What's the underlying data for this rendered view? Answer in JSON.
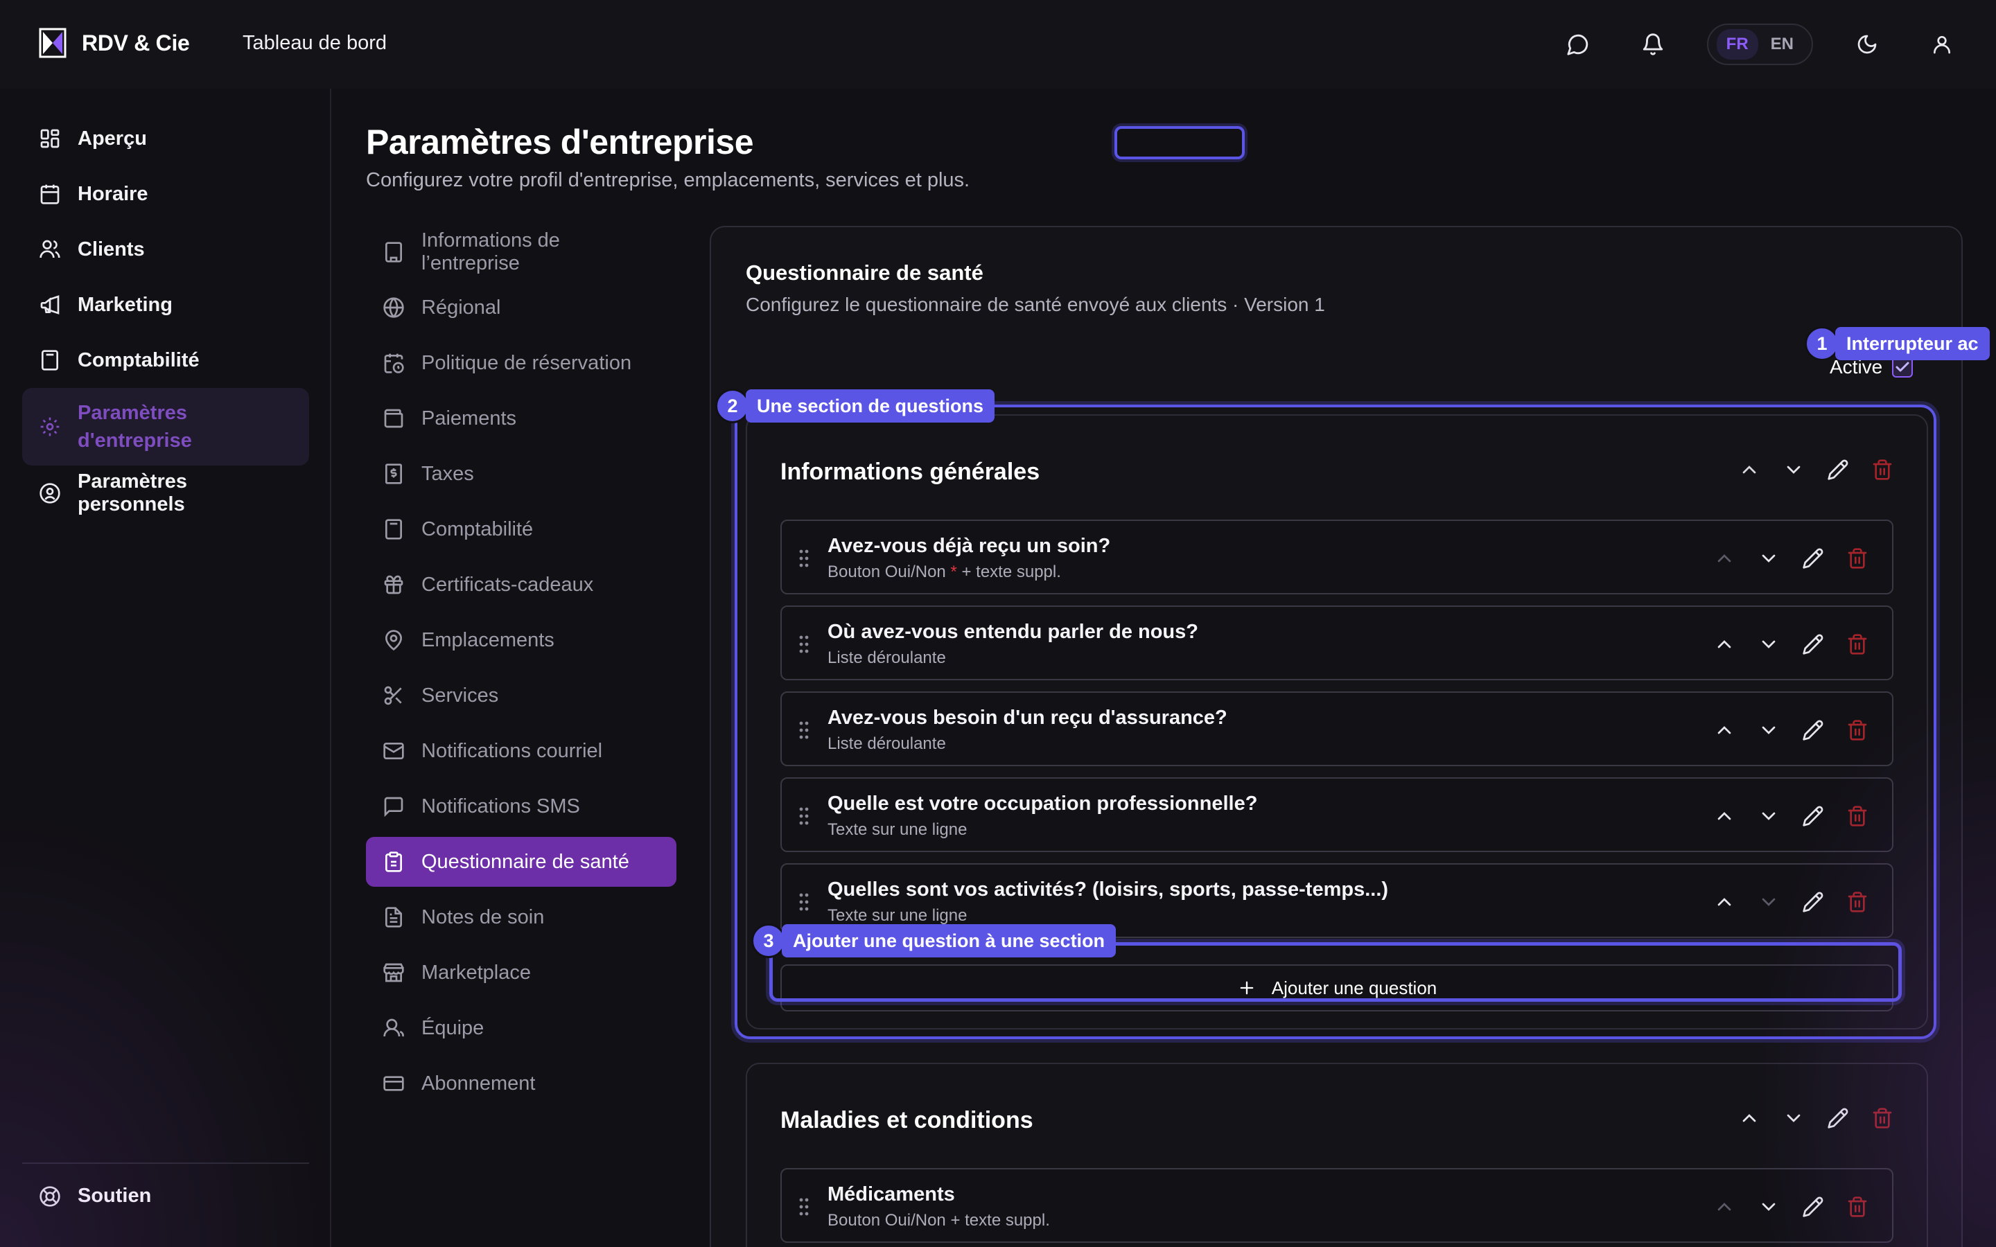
{
  "app": {
    "name": "RDV & Cie",
    "breadcrumb": "Tableau de bord"
  },
  "lang": {
    "fr": "FR",
    "en": "EN",
    "selected": "FR"
  },
  "sidebar": {
    "items": [
      {
        "label": "Aperçu",
        "icon": "dashboard-icon"
      },
      {
        "label": "Horaire",
        "icon": "calendar-icon"
      },
      {
        "label": "Clients",
        "icon": "users-icon"
      },
      {
        "label": "Marketing",
        "icon": "megaphone-icon"
      },
      {
        "label": "Comptabilité",
        "icon": "calculator-icon"
      },
      {
        "label": "Paramètres d'entreprise",
        "icon": "gear-icon",
        "active": true
      },
      {
        "label": "Paramètres personnels",
        "icon": "user-circle-icon"
      }
    ],
    "support": "Soutien"
  },
  "page": {
    "title": "Paramètres d'entreprise",
    "subtitle": "Configurez votre profil d'entreprise, emplacements, services et plus."
  },
  "settings_nav": [
    {
      "label": "Informations de l’entreprise",
      "icon": "building-icon"
    },
    {
      "label": "Régional",
      "icon": "globe-icon"
    },
    {
      "label": "Politique de réservation",
      "icon": "calendar-clock-icon"
    },
    {
      "label": "Paiements",
      "icon": "wallet-icon"
    },
    {
      "label": "Taxes",
      "icon": "receipt-dollar-icon"
    },
    {
      "label": "Comptabilité",
      "icon": "calculator-icon"
    },
    {
      "label": "Certificats-cadeaux",
      "icon": "gift-icon"
    },
    {
      "label": "Emplacements",
      "icon": "map-pin-icon"
    },
    {
      "label": "Services",
      "icon": "scissors-icon"
    },
    {
      "label": "Notifications courriel",
      "icon": "mail-icon"
    },
    {
      "label": "Notifications SMS",
      "icon": "message-square-icon"
    },
    {
      "label": "Questionnaire de santé",
      "icon": "clipboard-icon",
      "active": true
    },
    {
      "label": "Notes de soin",
      "icon": "file-text-icon"
    },
    {
      "label": "Marketplace",
      "icon": "store-icon"
    },
    {
      "label": "Équipe",
      "icon": "team-icon"
    },
    {
      "label": "Abonnement",
      "icon": "credit-card-icon"
    }
  ],
  "card": {
    "title": "Questionnaire de santé",
    "subtitle": "Configurez le questionnaire de santé envoyé aux clients · Version 1",
    "active_label": "Active",
    "active_checked": true
  },
  "sections": [
    {
      "title": "Informations générales",
      "questions": [
        {
          "title": "Avez-vous déjà reçu un soin?",
          "type": "Bouton Oui/Non",
          "required": true,
          "extra": "+ texte suppl."
        },
        {
          "title": "Où avez-vous entendu parler de nous?",
          "type": "Liste déroulante"
        },
        {
          "title": "Avez-vous besoin d'un reçu d'assurance?",
          "type": "Liste déroulante"
        },
        {
          "title": "Quelle est votre occupation professionnelle?",
          "type": "Texte sur une ligne"
        },
        {
          "title": "Quelles sont vos activités? (loisirs, sports, passe-temps...)",
          "type": "Texte sur une ligne"
        }
      ],
      "add_question": "Ajouter une question"
    },
    {
      "title": "Maladies et conditions",
      "questions": [
        {
          "title": "Médicaments",
          "type": "Bouton Oui/Non + texte suppl."
        }
      ]
    }
  ],
  "annotations": [
    {
      "num": "1",
      "label": "Interrupteur ac"
    },
    {
      "num": "2",
      "label": "Une section de questions"
    },
    {
      "num": "3",
      "label": "Ajouter une question à une section"
    }
  ],
  "colors": {
    "accent": "#6d2fa8",
    "highlight": "#5b55e6",
    "danger": "#a3242b",
    "bg": "#111014"
  }
}
